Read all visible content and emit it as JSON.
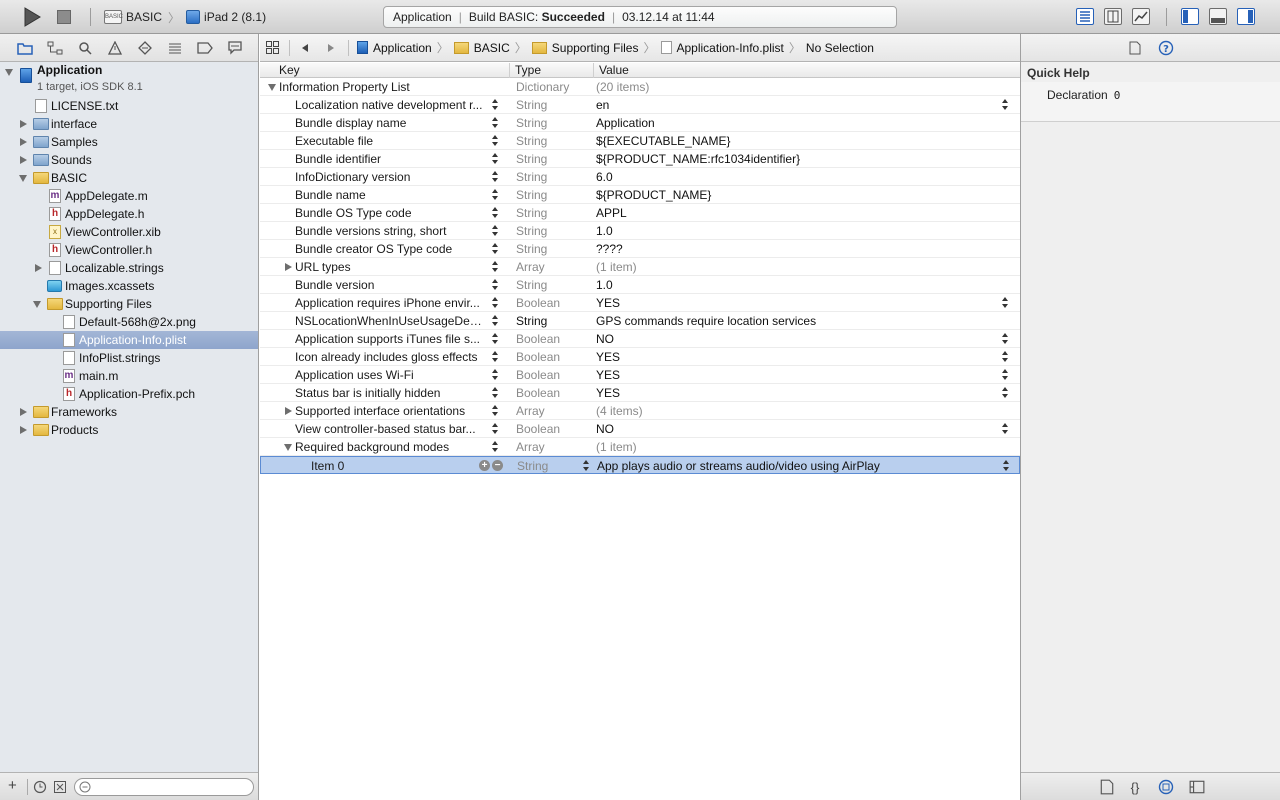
{
  "toolbar": {
    "scheme_name": "BASIC",
    "device_name": "iPad 2 (8.1)",
    "activity": {
      "project": "Application",
      "build_prefix": "Build BASIC:",
      "build_status": "Succeeded",
      "timestamp": "03.12.14 at 11:44"
    }
  },
  "navigator": {
    "project": {
      "name": "Application",
      "subtitle": "1 target, iOS SDK 8.1"
    },
    "items": [
      {
        "label": "LICENSE.txt"
      },
      {
        "label": "interface"
      },
      {
        "label": "Samples"
      },
      {
        "label": "Sounds"
      },
      {
        "label": "BASIC"
      },
      {
        "label": "AppDelegate.m"
      },
      {
        "label": "AppDelegate.h"
      },
      {
        "label": "ViewController.xib"
      },
      {
        "label": "ViewController.h"
      },
      {
        "label": "Localizable.strings"
      },
      {
        "label": "Images.xcassets"
      },
      {
        "label": "Supporting Files"
      },
      {
        "label": "Default-568h@2x.png"
      },
      {
        "label": "Application-Info.plist"
      },
      {
        "label": "InfoPlist.strings"
      },
      {
        "label": "main.m"
      },
      {
        "label": "Application-Prefix.pch"
      },
      {
        "label": "Frameworks"
      },
      {
        "label": "Products"
      }
    ]
  },
  "jumpbar": {
    "crumbs": [
      "Application",
      "BASIC",
      "Supporting Files",
      "Application-Info.plist",
      "No Selection"
    ]
  },
  "plist": {
    "headers": {
      "key": "Key",
      "type": "Type",
      "value": "Value"
    },
    "rows": [
      {
        "key": "Information Property List",
        "type": "Dictionary",
        "value": "(20 items)"
      },
      {
        "key": "Localization native development r...",
        "type": "String",
        "value": "en"
      },
      {
        "key": "Bundle display name",
        "type": "String",
        "value": "Application"
      },
      {
        "key": "Executable file",
        "type": "String",
        "value": "${EXECUTABLE_NAME}"
      },
      {
        "key": "Bundle identifier",
        "type": "String",
        "value": "${PRODUCT_NAME:rfc1034identifier}"
      },
      {
        "key": "InfoDictionary version",
        "type": "String",
        "value": "6.0"
      },
      {
        "key": "Bundle name",
        "type": "String",
        "value": "${PRODUCT_NAME}"
      },
      {
        "key": "Bundle OS Type code",
        "type": "String",
        "value": "APPL"
      },
      {
        "key": "Bundle versions string, short",
        "type": "String",
        "value": "1.0"
      },
      {
        "key": "Bundle creator OS Type code",
        "type": "String",
        "value": "????"
      },
      {
        "key": "URL types",
        "type": "Array",
        "value": "(1 item)"
      },
      {
        "key": "Bundle version",
        "type": "String",
        "value": "1.0"
      },
      {
        "key": "Application requires iPhone envir...",
        "type": "Boolean",
        "value": "YES"
      },
      {
        "key": "NSLocationWhenInUseUsageDescr...",
        "type": "String",
        "value": "GPS commands require location services"
      },
      {
        "key": "Application supports iTunes file s...",
        "type": "Boolean",
        "value": "NO"
      },
      {
        "key": "Icon already includes gloss effects",
        "type": "Boolean",
        "value": "YES"
      },
      {
        "key": "Application uses Wi-Fi",
        "type": "Boolean",
        "value": "YES"
      },
      {
        "key": "Status bar is initially hidden",
        "type": "Boolean",
        "value": "YES"
      },
      {
        "key": "Supported interface orientations",
        "type": "Array",
        "value": "(4 items)"
      },
      {
        "key": "View controller-based status bar...",
        "type": "Boolean",
        "value": "NO"
      },
      {
        "key": "Required background modes",
        "type": "Array",
        "value": "(1 item)"
      },
      {
        "key": "Item 0",
        "type": "String",
        "value": "App plays audio or streams audio/video using AirPlay"
      }
    ]
  },
  "inspector": {
    "title": "Quick Help",
    "declaration_label": "Declaration",
    "declaration_value": "0"
  },
  "colors": {
    "selection": "#8ea5cc",
    "build_succeeded": "#000000",
    "accent_blue": "#2761b8"
  }
}
